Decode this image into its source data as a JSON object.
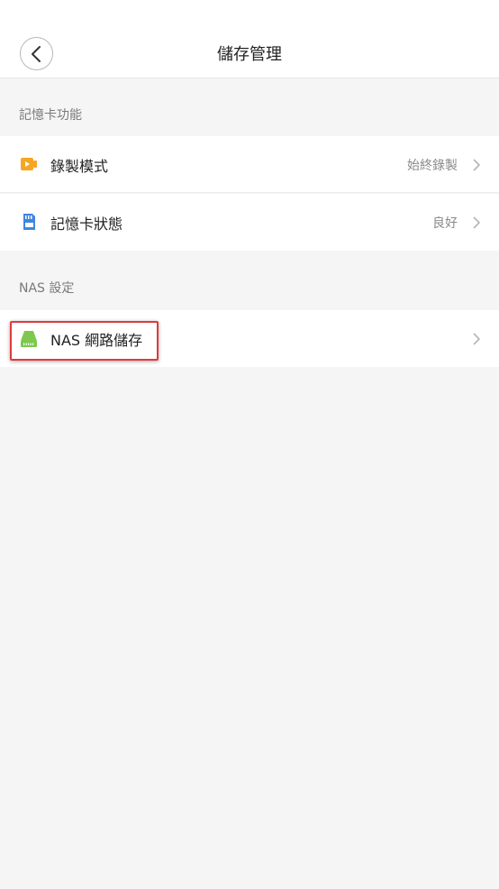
{
  "header": {
    "title": "儲存管理",
    "back_icon": "chevron-left-icon"
  },
  "sections": {
    "sd_card": {
      "label": "記憶卡功能",
      "items": [
        {
          "label": "錄製模式",
          "value": "始終錄製",
          "icon": "video-record-icon",
          "icon_color": "#f5a623"
        },
        {
          "label": "記憶卡狀態",
          "value": "良好",
          "icon": "sd-card-icon",
          "icon_color": "#3f86e0"
        }
      ]
    },
    "nas": {
      "label": "NAS 設定",
      "items": [
        {
          "label": "NAS 網路儲存",
          "value": "",
          "icon": "nas-drive-icon",
          "icon_color": "#7cc94d"
        }
      ]
    }
  },
  "colors": {
    "highlight": "#e0393e",
    "background": "#f5f5f5"
  }
}
